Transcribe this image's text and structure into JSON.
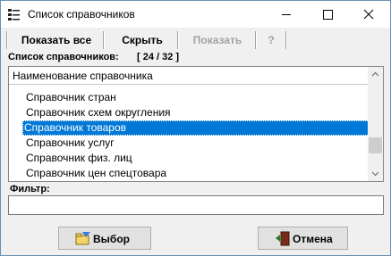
{
  "window": {
    "title": "Список справочников"
  },
  "toolbar": {
    "show_all": "Показать все",
    "hide": "Скрыть",
    "show": "Показать",
    "help": "?"
  },
  "list": {
    "caption": "Список справочников:",
    "counter": "[ 24 / 32 ]",
    "column_header": "Наименование справочника",
    "rows": [
      "Справочник стран",
      "Справочник схем округления",
      "Справочник товаров",
      "Справочник услуг",
      "Справочник физ. лиц",
      "Справочник цен спецтовара"
    ],
    "selected_index": 2
  },
  "filter": {
    "label": "Фильтр:",
    "value": ""
  },
  "buttons": {
    "select": "Выбор",
    "cancel": "Отмена"
  },
  "colors": {
    "selection": "#0078d7",
    "window_bg": "#f0f0f0",
    "disabled_text": "#a0a0a0"
  }
}
